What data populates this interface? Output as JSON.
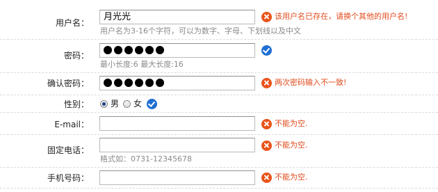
{
  "fields": {
    "username": {
      "label": "用户名：",
      "value": "月光光",
      "hint": "用户名为3-16个字符，可以为数字、字母、下划线以及中文",
      "error": "该用户名已存在，请换个其他的用户名!"
    },
    "password": {
      "label": "密码：",
      "masked_value": "●●●●●●",
      "hint": "最小长度:6 最大长度:16",
      "status": "valid"
    },
    "confirm_password": {
      "label": "确认密码：",
      "masked_value": "●●●●●●",
      "error": "两次密码输入不一致!"
    },
    "gender": {
      "label": "性别：",
      "options": [
        {
          "label": "男",
          "selected": true
        },
        {
          "label": "女",
          "selected": false
        }
      ],
      "status": "valid"
    },
    "email": {
      "label": "E-mail：",
      "value": "",
      "error": "不能为空."
    },
    "phone": {
      "label": "固定电话：",
      "value": "",
      "hint": "格式如：0731-12345678",
      "error": "不能为空."
    },
    "mobile": {
      "label": "手机号码：",
      "value": "",
      "error": "不能为空."
    }
  },
  "colors": {
    "error": "#e14b1b",
    "ok": "#1f6fd2",
    "hint": "#8a8a8a"
  },
  "icons": {
    "error": "error-x-circle-icon",
    "ok": "check-circle-icon"
  }
}
